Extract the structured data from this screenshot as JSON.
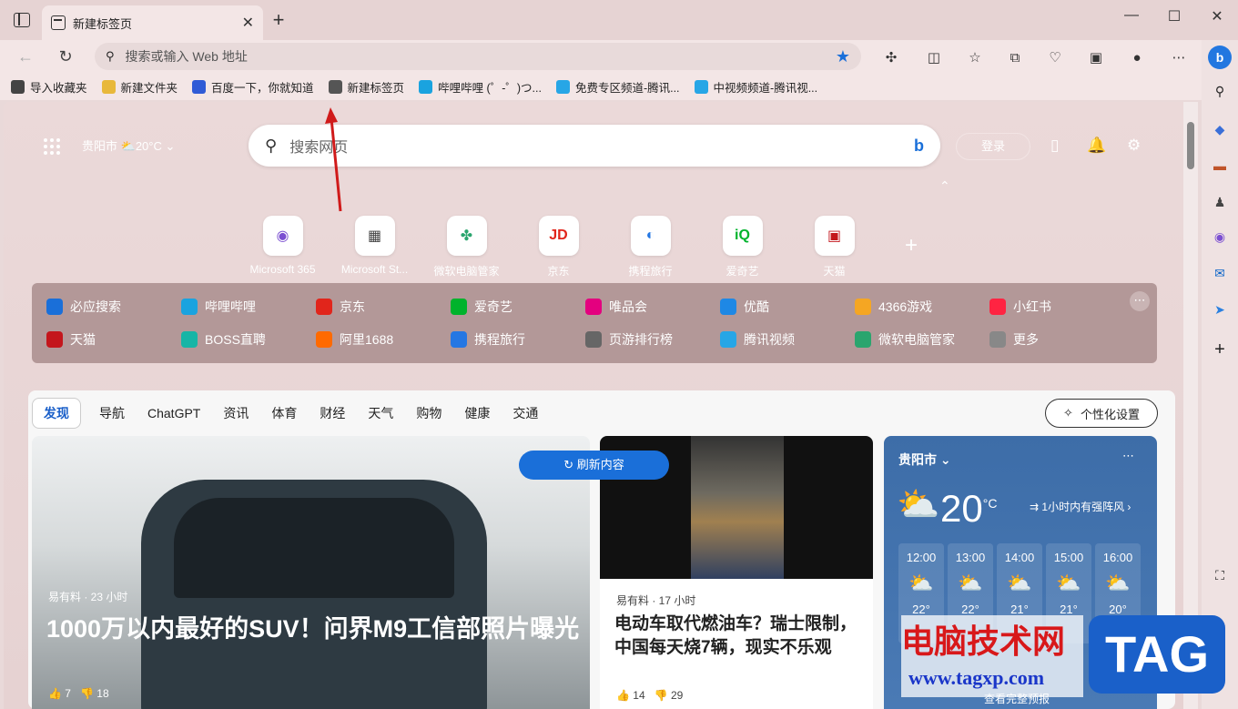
{
  "tab": {
    "title": "新建标签页"
  },
  "address": {
    "placeholder": "搜索或输入 Web 地址"
  },
  "bookmarks": [
    {
      "label": "导入收藏夹",
      "color": "#444"
    },
    {
      "label": "新建文件夹",
      "color": "#e8b83a"
    },
    {
      "label": "百度一下，你就知道",
      "color": "#2f5bd6"
    },
    {
      "label": "新建标签页",
      "color": "#555"
    },
    {
      "label": "哔哩哔哩 (゜-゜)つ...",
      "color": "#1aa3df"
    },
    {
      "label": "免费专区频道-腾讯...",
      "color": "#27a6e6"
    },
    {
      "label": "中视频频道-腾讯视...",
      "color": "#27a6e6"
    }
  ],
  "header": {
    "city": "贵阳市",
    "temp": "20°C",
    "search_placeholder": "搜索网页",
    "login": "登录"
  },
  "tiles": [
    {
      "label": "Microsoft 365",
      "glyph": "◉",
      "color": "#7b4fd1"
    },
    {
      "label": "Microsoft St...",
      "glyph": "▦",
      "color": "#444"
    },
    {
      "label": "微软电脑管家",
      "glyph": "✤",
      "color": "#2aa56e"
    },
    {
      "label": "京东",
      "glyph": "JD",
      "color": "#e1251b"
    },
    {
      "label": "携程旅行",
      "glyph": "◐",
      "color": "#2577e3"
    },
    {
      "label": "爱奇艺",
      "glyph": "iQ",
      "color": "#00b32c"
    },
    {
      "label": "天猫",
      "glyph": "▣",
      "color": "#c4161c"
    }
  ],
  "quick": [
    {
      "label": "必应搜索",
      "color": "#1a6fd9"
    },
    {
      "label": "哔哩哔哩",
      "color": "#1aa3df"
    },
    {
      "label": "京东",
      "color": "#e1251b"
    },
    {
      "label": "爱奇艺",
      "color": "#00b32c"
    },
    {
      "label": "唯品会",
      "color": "#e4007f"
    },
    {
      "label": "优酷",
      "color": "#1e88e5"
    },
    {
      "label": "4366游戏",
      "color": "#f5a623"
    },
    {
      "label": "小红书",
      "color": "#ff2442"
    },
    {
      "label": "天猫",
      "color": "#c4161c"
    },
    {
      "label": "BOSS直聘",
      "color": "#16b5a6"
    },
    {
      "label": "阿里1688",
      "color": "#ff6a00"
    },
    {
      "label": "携程旅行",
      "color": "#2577e3"
    },
    {
      "label": "页游排行榜",
      "color": "#666"
    },
    {
      "label": "腾讯视频",
      "color": "#27a6e6"
    },
    {
      "label": "微软电脑管家",
      "color": "#2aa56e"
    },
    {
      "label": "更多",
      "color": "#888"
    }
  ],
  "feed_tabs": [
    "发现",
    "导航",
    "ChatGPT",
    "资讯",
    "体育",
    "财经",
    "天气",
    "购物",
    "健康",
    "交通"
  ],
  "personalize": "个性化设置",
  "refresh": "刷新内容",
  "hero": {
    "source": "易有料 · 23 小时",
    "title": "1000万以内最好的SUV！问界M9工信部照片曝光",
    "likes": "7",
    "dislikes": "18"
  },
  "card2": {
    "source": "易有料 · 17 小时",
    "title": "电动车取代燃油车？瑞士限制，中国每天烧7辆，现实不乐观",
    "likes": "14",
    "dislikes": "29"
  },
  "weather": {
    "city": "贵阳市",
    "temp": "20",
    "unit": "°C",
    "alert": "1小时内有强阵风",
    "hours": [
      "12:00",
      "13:00",
      "14:00",
      "15:00",
      "16:00"
    ],
    "temps": [
      "22°",
      "22°",
      "21°",
      "21°",
      "20°"
    ],
    "footer": "查看完整预报"
  },
  "watermark": {
    "line1": "电脑技术网",
    "line2": "www.tagxp.com",
    "tag": "TAG"
  }
}
